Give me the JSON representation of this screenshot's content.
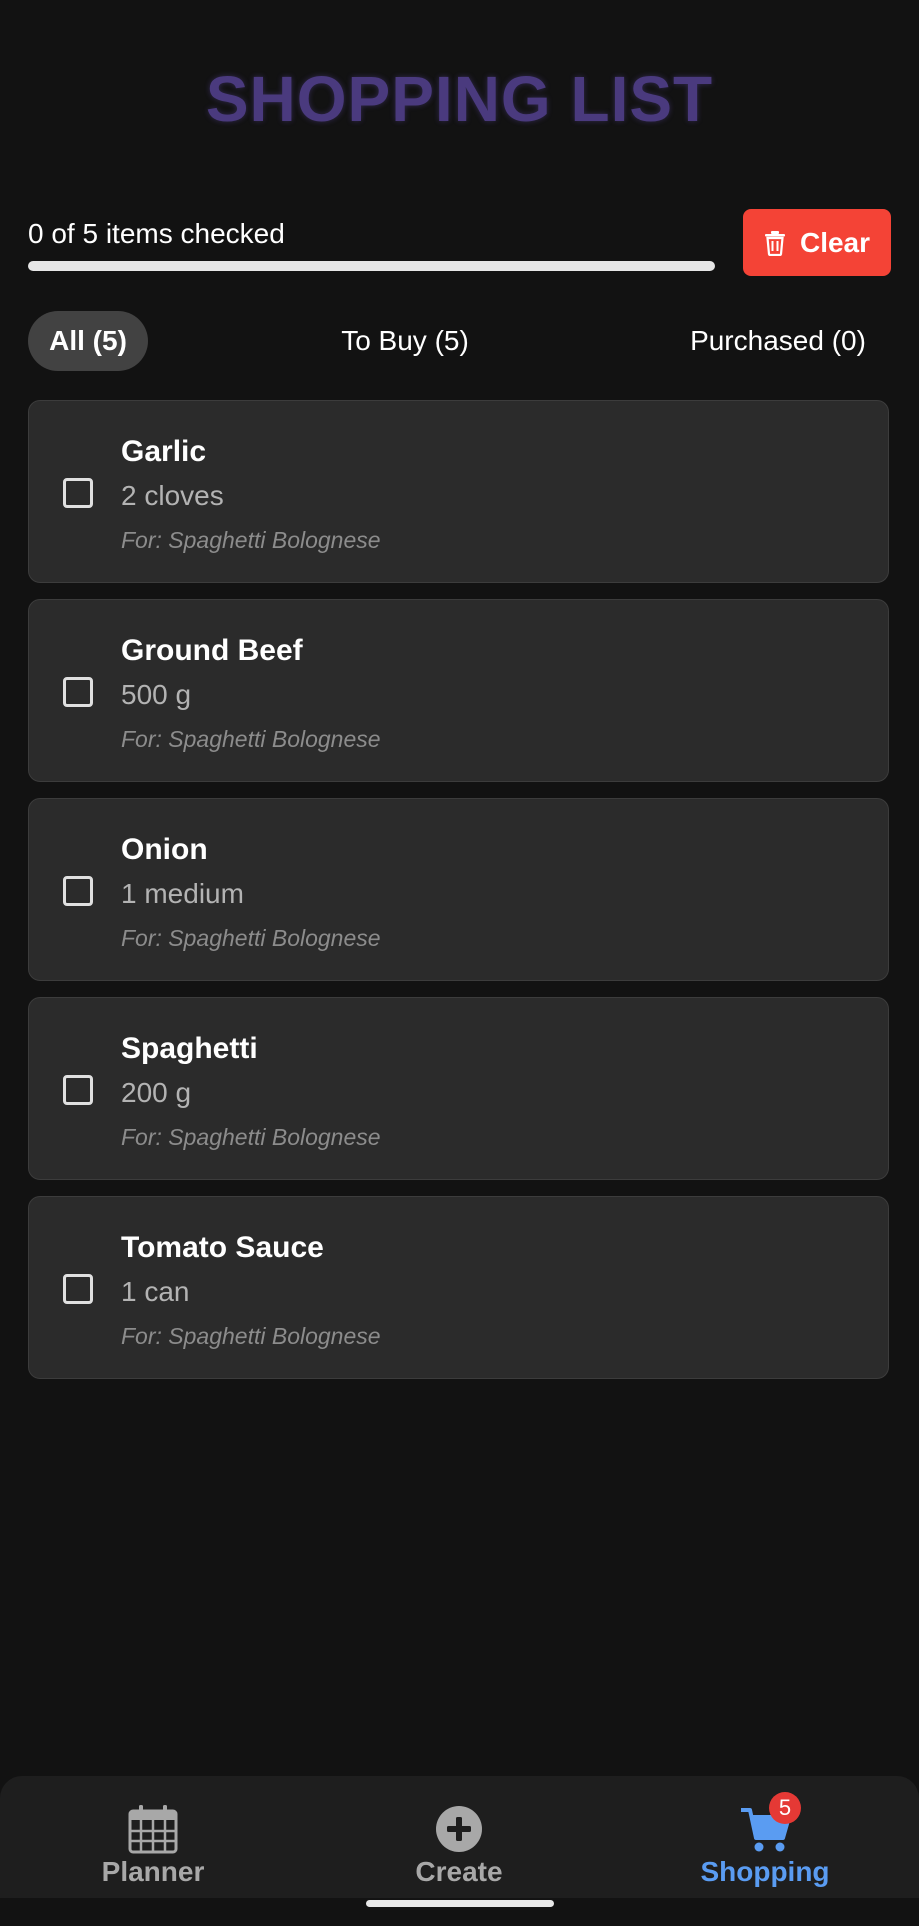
{
  "header": {
    "title": "SHOPPING LIST"
  },
  "progress": {
    "label": "0 of 5 items checked",
    "checked": 0,
    "total": 5
  },
  "clear_button": {
    "label": "Clear",
    "icon": "trash-icon",
    "color": "#f44336"
  },
  "filters": [
    {
      "label": "All (5)",
      "active": true
    },
    {
      "label": "To Buy (5)",
      "active": false
    },
    {
      "label": "Purchased (0)",
      "active": false
    }
  ],
  "items": [
    {
      "name": "Garlic",
      "quantity": "2 cloves",
      "recipe": "For: Spaghetti Bolognese",
      "checked": false
    },
    {
      "name": "Ground Beef",
      "quantity": "500 g",
      "recipe": "For: Spaghetti Bolognese",
      "checked": false
    },
    {
      "name": "Onion",
      "quantity": "1 medium",
      "recipe": "For: Spaghetti Bolognese",
      "checked": false
    },
    {
      "name": "Spaghetti",
      "quantity": "200 g",
      "recipe": "For: Spaghetti Bolognese",
      "checked": false
    },
    {
      "name": "Tomato Sauce",
      "quantity": "1 can",
      "recipe": "For: Spaghetti Bolognese",
      "checked": false
    }
  ],
  "bottom_nav": {
    "planner": {
      "label": "Planner",
      "icon": "calendar-icon"
    },
    "create": {
      "label": "Create",
      "icon": "plus-circle-icon"
    },
    "shopping": {
      "label": "Shopping",
      "icon": "cart-icon",
      "badge": "5",
      "active": true
    }
  },
  "colors": {
    "accent": "#5a9cf2",
    "title": "#4a3a7e",
    "badge": "#e53935",
    "background": "#121212",
    "card": "#2b2b2b"
  }
}
